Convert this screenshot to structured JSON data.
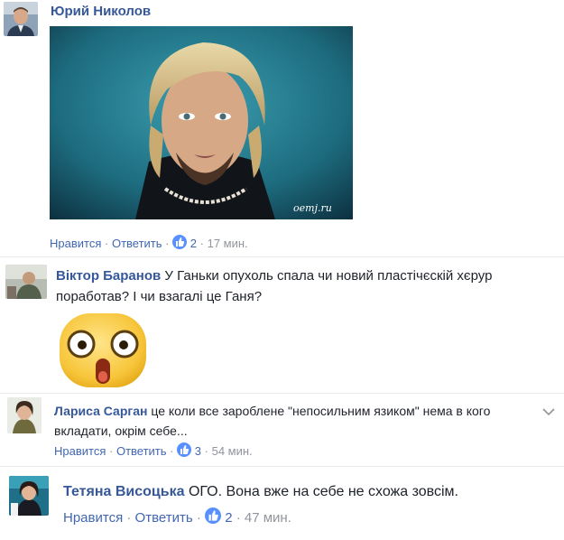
{
  "comments": [
    {
      "author": "Юрий Николов",
      "image_watermark": "oemj.ru",
      "like_label": "Нравится",
      "reply_label": "Ответить",
      "reactions": "2",
      "time": "17 мин."
    },
    {
      "author": "Віктор Баранов",
      "text_line1": "У Ганьки опухоль спала чи новий пластічєскій хєрур",
      "text_line2": "поработав? І чи взагалі це Ганя?",
      "sticker": "shocked-face-sticker"
    },
    {
      "author": "Лариса Сарган",
      "text_line1": "це коли все зароблене \"непосильним язиком\" нема в кого",
      "text_line2": "вкладати, окрім себе...",
      "like_label": "Нравится",
      "reply_label": "Ответить",
      "reactions": "3",
      "time": "54 мин."
    },
    {
      "author": "Тетяна Висоцька",
      "text": "ОГО. Вона вже на себе не схожа зовсім.",
      "like_label": "Нравится",
      "reply_label": "Ответить",
      "reactions": "2",
      "time": "47 мин."
    }
  ],
  "colors": {
    "author_link": "#365899",
    "action_link": "#4267b2",
    "meta_gray": "#90949c",
    "like_blue": "#5890ff",
    "divider": "#e9ebee"
  },
  "icons": {
    "like": "thumbs-up-icon",
    "menu": "chevron-down-icon"
  }
}
